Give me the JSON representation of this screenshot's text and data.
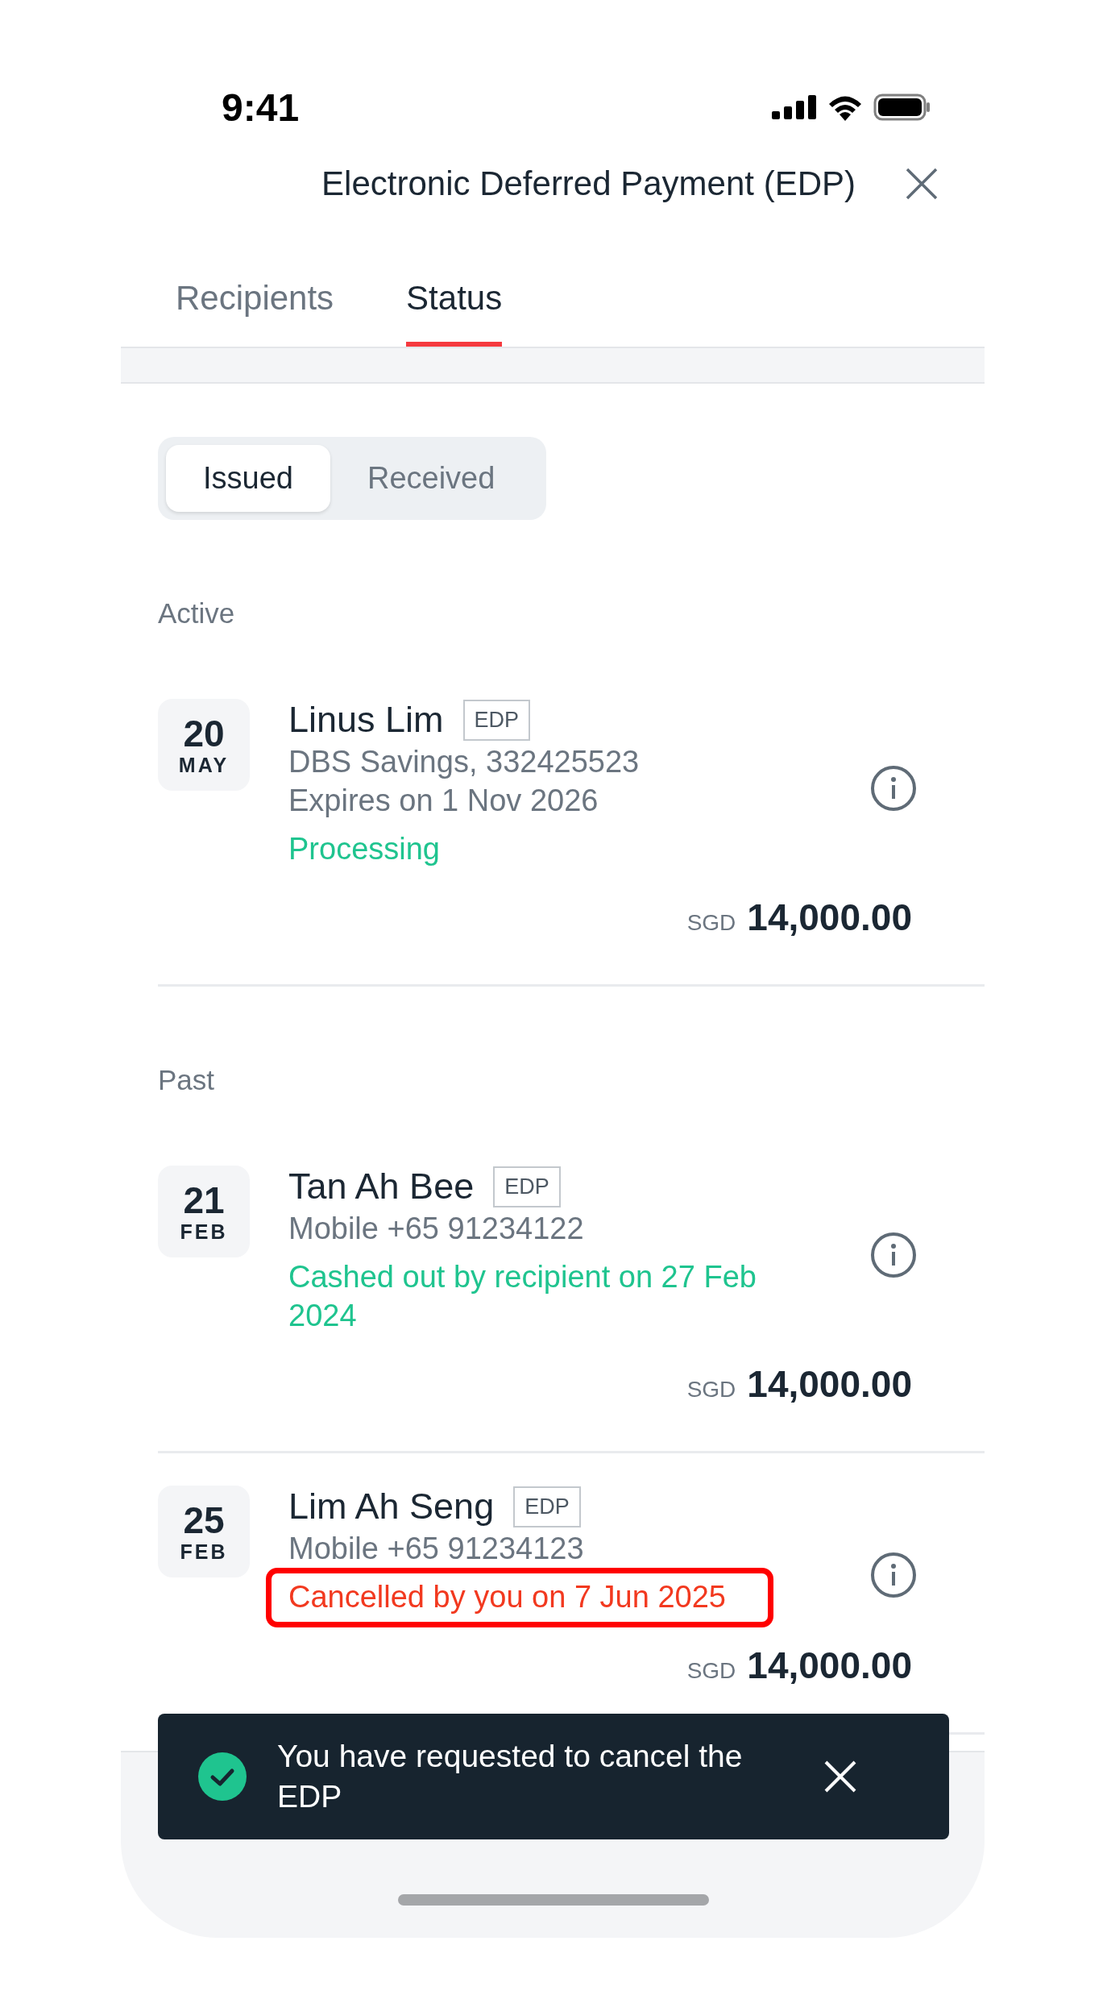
{
  "status_bar": {
    "time": "9:41"
  },
  "header": {
    "title": "Electronic Deferred Payment (EDP)"
  },
  "tabs": [
    {
      "label": "Recipients",
      "selected": false
    },
    {
      "label": "Status",
      "selected": true
    }
  ],
  "segments": [
    {
      "label": "Issued",
      "selected": true
    },
    {
      "label": "Received",
      "selected": false
    }
  ],
  "sections": [
    {
      "title": "Active",
      "items": [
        {
          "day": "20",
          "month": "MAY",
          "name": "Linus Lim",
          "tag": "EDP",
          "details": [
            "DBS Savings, 332425523",
            "Expires on 1 Nov 2026"
          ],
          "status": "Processing",
          "color": "#1fc48f",
          "highlighted": false,
          "currency": "SGD",
          "amount": "14,000.00"
        }
      ]
    },
    {
      "title": "Past",
      "items": [
        {
          "day": "21",
          "month": "FEB",
          "name": "Tan Ah Bee",
          "tag": "EDP",
          "details": [
            "Mobile +65 91234122"
          ],
          "status": "Cashed out by recipient on 27 Feb 2024",
          "color": "#1fc48f",
          "highlighted": false,
          "currency": "SGD",
          "amount": "14,000.00"
        },
        {
          "day": "25",
          "month": "FEB",
          "name": "Lim Ah Seng",
          "tag": "EDP",
          "details": [
            "Mobile +65 91234123"
          ],
          "status": "Cancelled by you on 7 Jun 2025",
          "color": "#f2391f",
          "highlighted": true,
          "currency": "SGD",
          "amount": "14,000.00"
        }
      ]
    }
  ],
  "toast": {
    "message": "You have requested to cancel the EDP"
  }
}
